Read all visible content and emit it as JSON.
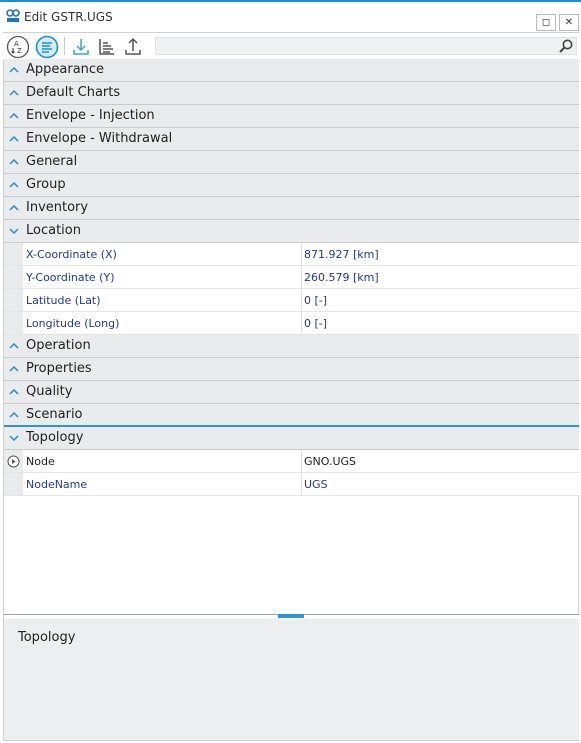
{
  "window": {
    "title": "Edit GSTR.UGS",
    "maximize_label": "◻",
    "close_label": "✕"
  },
  "toolbar": {
    "icons": [
      "sort-alphabetical-icon",
      "sort-categorized-icon",
      "import-icon",
      "collapse-tree-icon",
      "export-icon"
    ],
    "search_placeholder": "",
    "search_value": ""
  },
  "grid": {
    "categories": [
      {
        "label": "Appearance",
        "expanded": false
      },
      {
        "label": "Default Charts",
        "expanded": false
      },
      {
        "label": "Envelope - Injection",
        "expanded": false
      },
      {
        "label": "Envelope - Withdrawal",
        "expanded": false
      },
      {
        "label": "General",
        "expanded": false
      },
      {
        "label": "Group",
        "expanded": false
      },
      {
        "label": "Inventory",
        "expanded": false
      },
      {
        "label": "Location",
        "expanded": true
      },
      {
        "label": "Operation",
        "expanded": false
      },
      {
        "label": "Properties",
        "expanded": false
      },
      {
        "label": "Quality",
        "expanded": false
      },
      {
        "label": "Scenario",
        "expanded": false
      },
      {
        "label": "Topology",
        "expanded": true
      }
    ],
    "location_props": [
      {
        "name": "X-Coordinate (X)",
        "value": "871.927 [km]"
      },
      {
        "name": "Y-Coordinate (Y)",
        "value": "260.579 [km]"
      },
      {
        "name": "Latitude (Lat)",
        "value": "0 [-]"
      },
      {
        "name": "Longitude (Long)",
        "value": "0 [-]"
      }
    ],
    "topology_props": [
      {
        "name": "Node",
        "value": "GNO.UGS"
      },
      {
        "name": "NodeName",
        "value": "UGS"
      }
    ]
  },
  "description": {
    "title": "Topology"
  },
  "colors": {
    "accent": "#2b95d6",
    "category_bg": "#e9ebed",
    "property_text": "#1f3a8a"
  }
}
